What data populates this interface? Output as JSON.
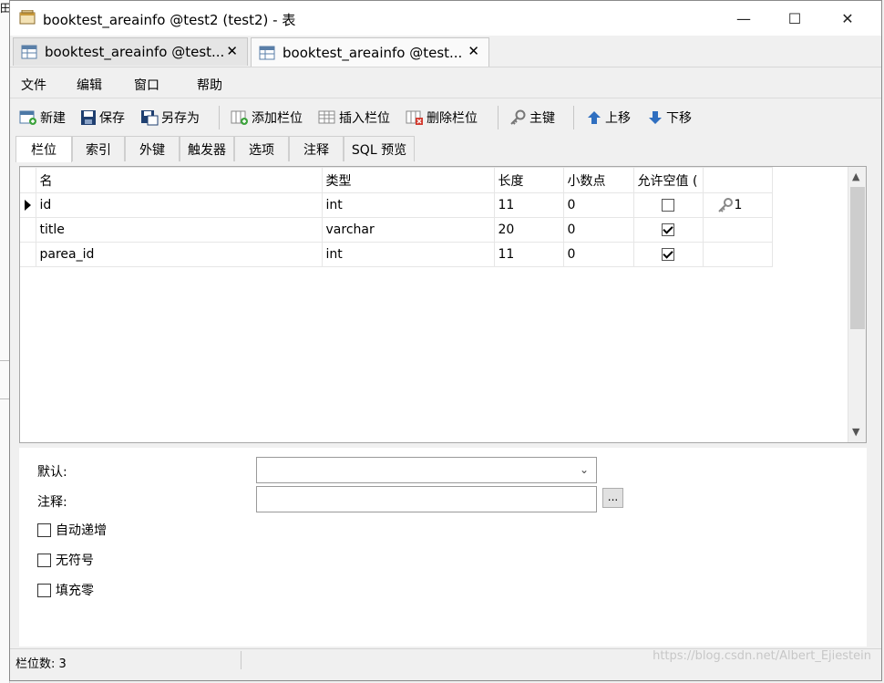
{
  "window": {
    "title": "booktest_areainfo @test2 (test2) - 表",
    "min_glyph": "—",
    "max_glyph": "☐",
    "close_glyph": "✕"
  },
  "doc_tabs": [
    {
      "label": "booktest_areainfo @test...",
      "close": "✕",
      "active": false
    },
    {
      "label": "booktest_areainfo @test...",
      "close": "✕",
      "active": true
    }
  ],
  "menu": [
    "文件",
    "编辑",
    "窗口",
    "帮助"
  ],
  "toolbar": {
    "new": "新建",
    "save": "保存",
    "save_as": "另存为",
    "add_column": "添加栏位",
    "insert_column": "插入栏位",
    "delete_column": "删除栏位",
    "primary_key": "主键",
    "move_up": "上移",
    "move_down": "下移"
  },
  "inner_tabs": [
    "栏位",
    "索引",
    "外键",
    "触发器",
    "选项",
    "注释",
    "SQL 预览"
  ],
  "grid": {
    "headers": [
      "名",
      "类型",
      "长度",
      "小数点",
      "允许空值 ("
    ],
    "rows": [
      {
        "name": "id",
        "type": "int",
        "length": "11",
        "decimals": "0",
        "nullable": false,
        "key": "1",
        "current": true
      },
      {
        "name": "title",
        "type": "varchar",
        "length": "20",
        "decimals": "0",
        "nullable": true,
        "key": "",
        "current": false
      },
      {
        "name": "parea_id",
        "type": "int",
        "length": "11",
        "decimals": "0",
        "nullable": true,
        "key": "",
        "current": false
      }
    ]
  },
  "form": {
    "default_label": "默认:",
    "default_value": "",
    "comment_label": "注释:",
    "comment_value": "",
    "dots": "...",
    "auto_increment": "自动递增",
    "unsigned": "无符号",
    "zerofill": "填充零"
  },
  "status": {
    "column_count": "栏位数: 3"
  },
  "watermark": "https://blog.csdn.net/Albert_Ejiestein"
}
